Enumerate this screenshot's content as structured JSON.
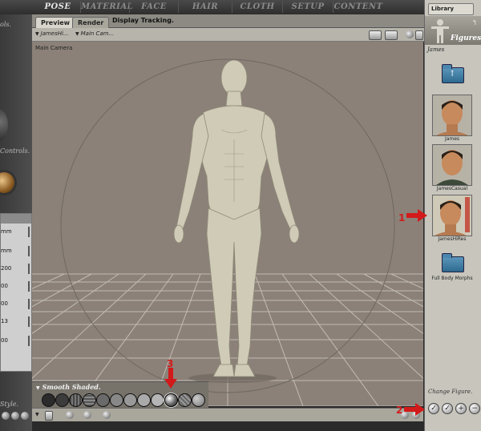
{
  "rooms": {
    "tabs": [
      "POSE",
      "MATERIAL",
      "FACE",
      "HAIR",
      "CLOTH",
      "SETUP",
      "CONTENT"
    ],
    "active": "POSE"
  },
  "left_panel": {
    "text_top": "ols.",
    "controls_label": "Controls.",
    "style_label": "Style.",
    "param_rows": [
      "mm",
      "mm",
      "200",
      "00",
      "00",
      "13",
      "00"
    ]
  },
  "document": {
    "tabs": [
      "Preview",
      "Render"
    ],
    "active_tab": "Preview",
    "display_tracking": "Display Tracking.",
    "figure_dropdown": "JamesHi...",
    "camera_dropdown": "Main Cam...",
    "camera_label": "Main Camera",
    "style_label": "Smooth Shaded.",
    "style_swatch_count": 12
  },
  "library": {
    "tab": "Library",
    "header_title": "Figures",
    "category": "James",
    "items": [
      {
        "type": "folder",
        "label": ""
      },
      {
        "type": "figure",
        "label": "James"
      },
      {
        "type": "figure",
        "label": "JamesCasual"
      },
      {
        "type": "figure",
        "label": "JamesHiRes"
      },
      {
        "type": "folder",
        "label": "Full Body Morphs"
      }
    ],
    "change_figure": "Change Figure."
  },
  "callouts": [
    "1",
    "2",
    "3"
  ],
  "colors": {
    "viewport_bg": "#8b8178",
    "skin": "#cfcbb6",
    "callout_red": "#d21a1a"
  }
}
